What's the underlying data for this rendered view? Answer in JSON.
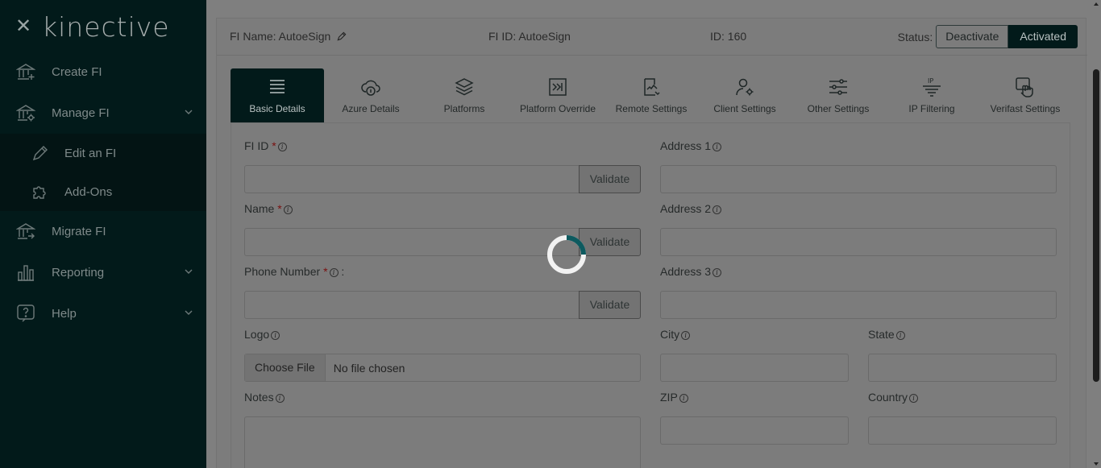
{
  "sidebar": {
    "brand": "kinective",
    "close_icon": "close-icon",
    "items": [
      {
        "label": "Create FI",
        "icon": "bank-plus-icon"
      },
      {
        "label": "Manage FI",
        "icon": "bank-gear-icon",
        "expandable": true
      },
      {
        "label": "Edit an FI",
        "icon": "pencil-icon",
        "sub": true
      },
      {
        "label": "Add-Ons",
        "icon": "puzzle-icon",
        "sub": true
      },
      {
        "label": "Migrate FI",
        "icon": "bank-arrow-icon"
      },
      {
        "label": "Reporting",
        "icon": "bar-chart-icon",
        "expandable": true
      },
      {
        "label": "Help",
        "icon": "help-icon",
        "expandable": true
      }
    ]
  },
  "header": {
    "fi_name": "FI Name: AutoeSign",
    "fi_id": "FI ID: AutoeSign",
    "id": "ID: 160",
    "status_label": "Status:",
    "deactivate": "Deactivate",
    "activated": "Activated"
  },
  "tabs": [
    {
      "label": "Basic Details",
      "icon": "list-icon",
      "active": true
    },
    {
      "label": "Azure Details",
      "icon": "cloud-info-icon"
    },
    {
      "label": "Platforms",
      "icon": "layers-icon"
    },
    {
      "label": "Platform Override",
      "icon": "override-icon"
    },
    {
      "label": "Remote Settings",
      "icon": "remote-doc-icon"
    },
    {
      "label": "Client Settings",
      "icon": "user-gear-icon"
    },
    {
      "label": "Other Settings",
      "icon": "sliders-icon"
    },
    {
      "label": "IP Filtering",
      "icon": "ip-filter-icon"
    },
    {
      "label": "Verifast Settings",
      "icon": "hand-touch-icon"
    }
  ],
  "form": {
    "fi_id_label": "FI ID",
    "name_label": "Name",
    "phone_label": "Phone Number",
    "phone_suffix": ":",
    "logo_label": "Logo",
    "notes_label": "Notes",
    "address1_label": "Address 1",
    "address2_label": "Address 2",
    "address3_label": "Address 3",
    "city_label": "City",
    "state_label": "State",
    "zip_label": "ZIP",
    "country_label": "Country",
    "validate": "Validate",
    "choose_file": "Choose File",
    "no_file": "No file chosen",
    "required_mark": "*",
    "info_mark": "i"
  },
  "colors": {
    "sidebar_bg": "#021a1a",
    "overlay_bg": "#7f7f7f",
    "spinner_accent": "#0d5a5f"
  }
}
